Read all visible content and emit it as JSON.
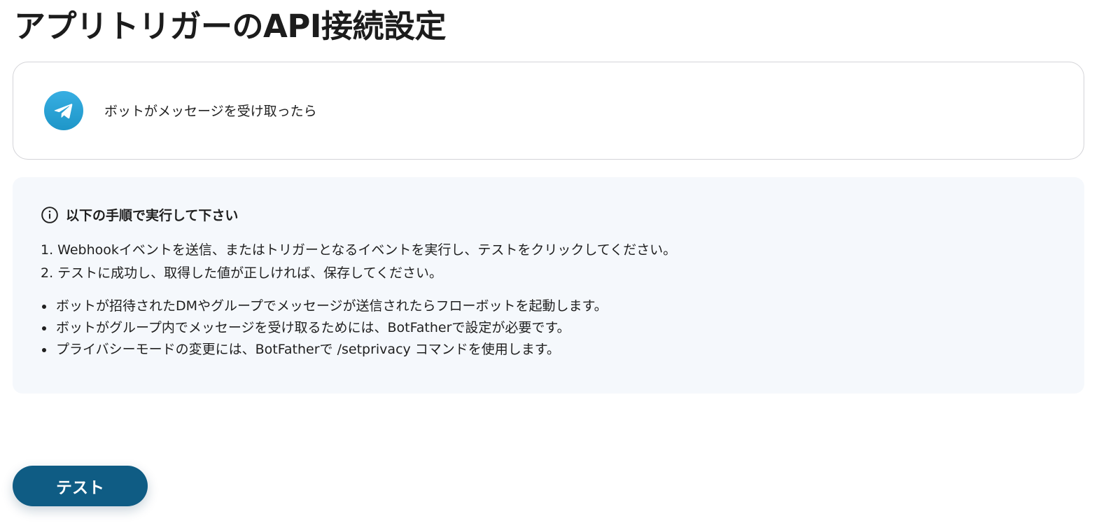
{
  "page": {
    "title": "アプリトリガーのAPI接続設定"
  },
  "trigger": {
    "app_icon": "telegram-paper-plane-icon",
    "label": "ボットがメッセージを受け取ったら"
  },
  "instructions": {
    "heading_icon": "info-circle-icon",
    "heading": "以下の手順で実行して下さい",
    "steps": [
      "1. Webhookイベントを送信、またはトリガーとなるイベントを実行し、テストをクリックしてください。",
      "2. テストに成功し、取得した値が正しければ、保存してください。"
    ],
    "notes": [
      "ボットが招待されたDMやグループでメッセージが送信されたらフローボットを起動します。",
      "ボットがグループ内でメッセージを受け取るためには、BotFatherで設定が必要です。",
      "プライバシーモードの変更には、BotFatherで /setprivacy コマンドを使用します。"
    ]
  },
  "actions": {
    "test_label": "テスト"
  },
  "colors": {
    "button_bg": "#0f5c84",
    "panel_bg": "#f5f8fc",
    "telegram_blue": "#2aa3dd"
  }
}
